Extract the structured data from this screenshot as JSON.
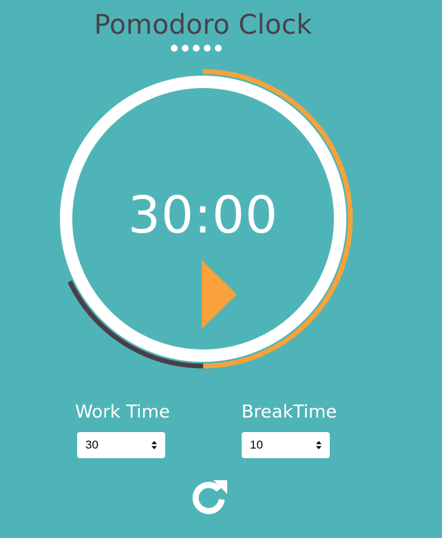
{
  "app": {
    "title": "Pomodoro Clock",
    "session_dots": 5
  },
  "timer": {
    "display": "30:00",
    "progress_work_fraction": 0.5,
    "progress_break_fraction": 0.18
  },
  "settings": {
    "work_label": "Work Time",
    "work_value": "30",
    "break_label": "BreakTime",
    "break_value": "10"
  },
  "icons": {
    "play": "play-icon",
    "reset": "reset-icon",
    "stepper": "updown-stepper-icon"
  },
  "colors": {
    "background": "#4fb4b7",
    "ring": "#ffffff",
    "work_progress": "#f9a13a",
    "break_progress": "#4a3f48",
    "play": "#f9a13a",
    "title": "#4a3f48"
  }
}
